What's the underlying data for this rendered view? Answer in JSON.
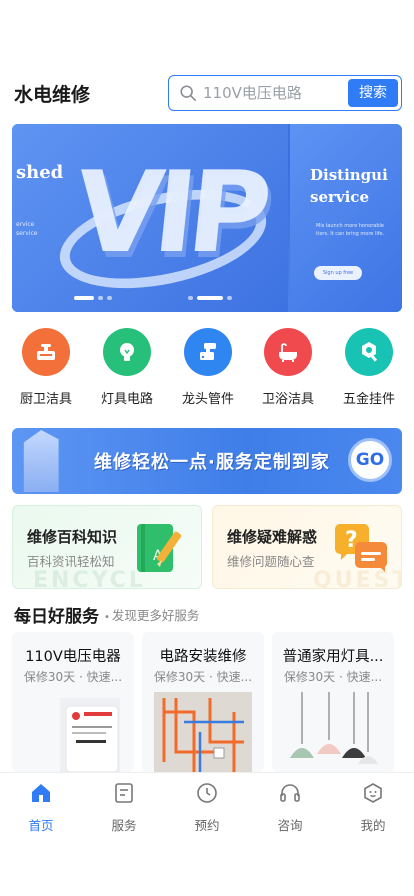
{
  "header": {
    "title": "水电维修",
    "search_placeholder": "110V电压电路",
    "search_button": "搜索"
  },
  "banner": {
    "left_word": "shed",
    "left_desc": "ervice\nservice",
    "center_word": "VIP",
    "side_title_1": "Distingui",
    "side_title_2": "service",
    "side_desc": "Mis launch more honorable tiers. It can bring more life.",
    "side_button": "Sign up free"
  },
  "categories": [
    {
      "label": "厨卫洁具",
      "color": "#f4703a",
      "icon": "faucet-box-icon"
    },
    {
      "label": "灯具电路",
      "color": "#27c07a",
      "icon": "bulb-icon"
    },
    {
      "label": "龙头管件",
      "color": "#2f86f0",
      "icon": "tap-icon"
    },
    {
      "label": "卫浴洁具",
      "color": "#f04a4f",
      "icon": "bathtub-icon"
    },
    {
      "label": "五金挂件",
      "color": "#19c3b3",
      "icon": "bolt-nut-icon"
    }
  ],
  "promo": {
    "text": "维修轻松一点·服务定制到家",
    "go": "GO"
  },
  "cards": {
    "left": {
      "title": "维修百科知识",
      "subtitle": "百科资讯轻松知",
      "bg": "ENCYCL"
    },
    "right": {
      "title": "维修疑难解惑",
      "subtitle": "维修问题随心查",
      "bg": "QUESTIO"
    }
  },
  "daily": {
    "title": "每日好服务",
    "subtitle": "发现更多好服务",
    "items": [
      {
        "title": "110V电压电器",
        "subtitle": "保修30天 · 快速..."
      },
      {
        "title": "电路安装维修",
        "subtitle": "保修30天 · 快速..."
      },
      {
        "title": "普通家用灯具...",
        "subtitle": "保修30天 · 快速..."
      }
    ]
  },
  "tabbar": [
    {
      "label": "首页",
      "icon": "home-icon",
      "active": true
    },
    {
      "label": "服务",
      "icon": "list-icon",
      "active": false
    },
    {
      "label": "预约",
      "icon": "clock-icon",
      "active": false
    },
    {
      "label": "咨询",
      "icon": "headset-icon",
      "active": false
    },
    {
      "label": "我的",
      "icon": "profile-icon",
      "active": false
    }
  ],
  "colors": {
    "accent": "#2f7cf6"
  }
}
